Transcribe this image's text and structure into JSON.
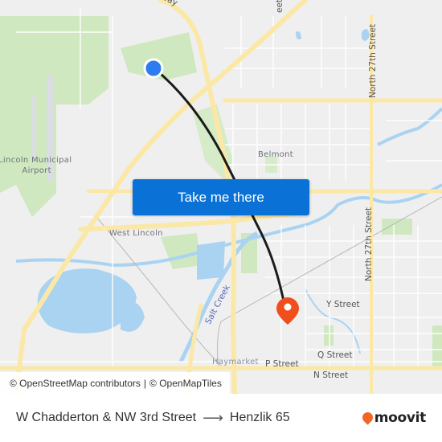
{
  "map": {
    "labels": {
      "airport": [
        "Lincoln Municipal",
        "Airport"
      ],
      "belmont": "Belmont",
      "west_lincoln": "West Lincoln",
      "haymarket": "Haymarket",
      "salt_creek": "Salt Creek"
    },
    "streets": {
      "north_27th_top": "North 27th Street",
      "north_27th_bottom": "North 27th Street",
      "y_street": "Y Street",
      "q_street": "Q Street",
      "p_street": "P Street",
      "n_street": "N Street",
      "highway_partial": "way",
      "street_partial": "eet"
    },
    "origin_marker": {
      "name": "W Chadderton & NW 3rd Street",
      "color": "#2f7bf0"
    },
    "destination_marker": {
      "name": "Henzlik 65",
      "color": "#f04e1c"
    },
    "route_color": "#1a1a1a"
  },
  "cta": {
    "label": "Take me there",
    "color": "#0a72d6"
  },
  "attribution": {
    "osm": "© OpenStreetMap contributors",
    "separator": "|",
    "omt": "© OpenMapTiles"
  },
  "footer": {
    "origin": "W Chadderton & NW 3rd Street",
    "arrow": "⟶",
    "destination": "Henzlik 65",
    "brand": "moovit",
    "brand_color": "#f26722"
  }
}
